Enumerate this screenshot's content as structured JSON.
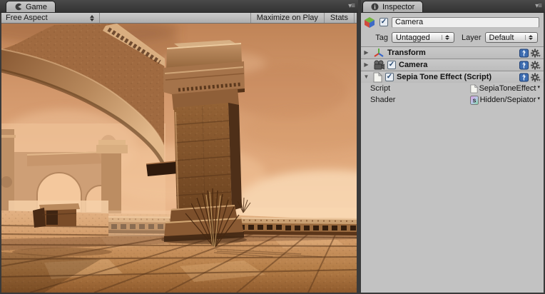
{
  "colors": {
    "chrome_dark": "#3a3a3a",
    "panel_bg": "#c2c2c2",
    "sepia_sky_mid": "#dca277",
    "sepia_stone_dark": "#6b421f",
    "sepia_horizon_light": "#f7d2ac"
  },
  "icons": {
    "panel_menu": "▾≡",
    "checkmark": "✓",
    "foldout_collapsed": "▶",
    "foldout_expanded": "▼",
    "object_picker": "▾",
    "help_q": "?",
    "shader_letter": "s",
    "info_i": "i"
  },
  "game_panel": {
    "tab_label": "Game",
    "aspect_menu": "Free Aspect",
    "maximize_button": "Maximize on Play",
    "stats_button": "Stats"
  },
  "inspector": {
    "tab_label": "Inspector",
    "header": {
      "name_value": "Camera",
      "tag_label": "Tag",
      "tag_value": "Untagged",
      "layer_label": "Layer",
      "layer_value": "Default"
    },
    "components": [
      {
        "name": "Transform"
      },
      {
        "name": "Camera"
      },
      {
        "name": "Sepia Tone Effect (Script)",
        "properties": [
          {
            "label": "Script",
            "value": "SepiaToneEffect"
          },
          {
            "label": "Shader",
            "value": "Hidden/Sepiator"
          }
        ]
      }
    ]
  }
}
